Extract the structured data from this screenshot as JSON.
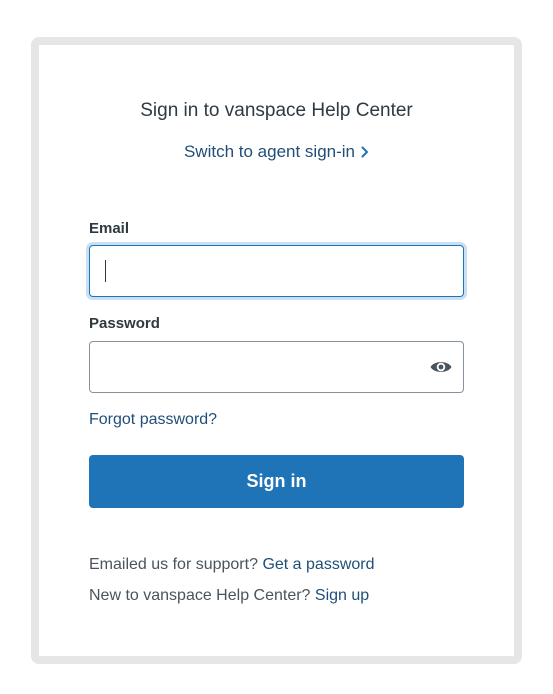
{
  "page": {
    "title": "Sign in to vanspace Help Center",
    "switch_link": "Switch to agent sign-in",
    "email_label": "Email",
    "email_value": "",
    "password_label": "Password",
    "password_value": "",
    "forgot_link": "Forgot password?",
    "signin_button": "Sign in",
    "support_prompt": "Emailed us for support?",
    "get_password_link": "Get a password",
    "new_prompt": "New to vanspace Help Center?",
    "signup_link": "Sign up"
  },
  "icons": {
    "switch_chevron": "chevron-right-icon",
    "password_toggle": "eye-icon"
  },
  "colors": {
    "accent": "#1f73b7",
    "link": "#1f4e79",
    "text": "#2f3941",
    "frame": "#e6e6e6"
  }
}
